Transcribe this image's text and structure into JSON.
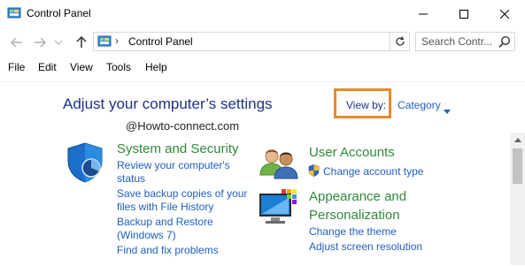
{
  "window": {
    "title": "Control Panel"
  },
  "address": {
    "path": "Control Panel",
    "separator": "›"
  },
  "search": {
    "placeholder": "Search Contr..."
  },
  "menu": [
    "File",
    "Edit",
    "View",
    "Tools",
    "Help"
  ],
  "main": {
    "heading": "Adjust your computer’s settings",
    "view_by_label": "View by:",
    "view_by_value": "Category",
    "watermark": "@Howto-connect.com"
  },
  "categories": {
    "system_security": {
      "title": "System and Security",
      "links": [
        "Review your computer's",
        "status",
        "Save backup copies of your",
        "files with File History",
        "Backup and Restore",
        "(Windows 7)",
        "Find and fix problems"
      ]
    },
    "user_accounts": {
      "title": "User Accounts",
      "links": [
        "Change account type"
      ]
    },
    "appearance": {
      "title_line1": "Appearance and",
      "title_line2": "Personalization",
      "links": [
        "Change the theme",
        "Adjust screen resolution"
      ]
    }
  },
  "colors": {
    "heading": "#1e3287",
    "category_title": "#2e8b3a",
    "link": "#1f5fbf",
    "highlight_box": "#e68a2e"
  },
  "icons": [
    "control-panel-icon",
    "minimize-icon",
    "maximize-icon",
    "close-icon",
    "back-arrow-icon",
    "forward-arrow-icon",
    "recent-dropdown-icon",
    "up-arrow-icon",
    "refresh-icon",
    "search-icon",
    "shield-icon",
    "users-icon",
    "uac-shield-icon",
    "monitor-palette-icon",
    "chevron-down-icon"
  ]
}
